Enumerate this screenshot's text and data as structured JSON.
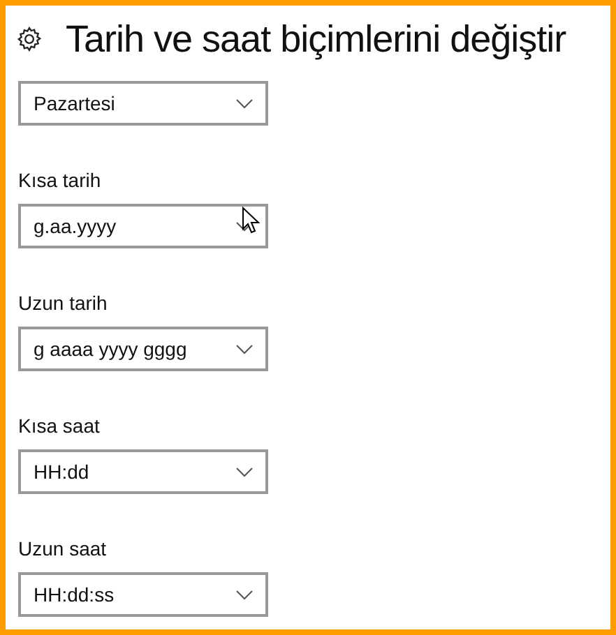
{
  "page": {
    "title": "Tarih ve saat biçimlerini değiştir"
  },
  "settings": [
    {
      "value": "Pazartesi",
      "pointer_over": false
    },
    {
      "label": "Kısa tarih",
      "value": "g.aa.yyyy",
      "pointer_over": true
    },
    {
      "label": "Uzun tarih",
      "value": "g aaaa yyyy gggg",
      "pointer_over": false
    },
    {
      "label": "Kısa saat",
      "value": "HH:dd",
      "pointer_over": false
    },
    {
      "label": "Uzun saat",
      "value": "HH:dd:ss",
      "pointer_over": false
    }
  ]
}
